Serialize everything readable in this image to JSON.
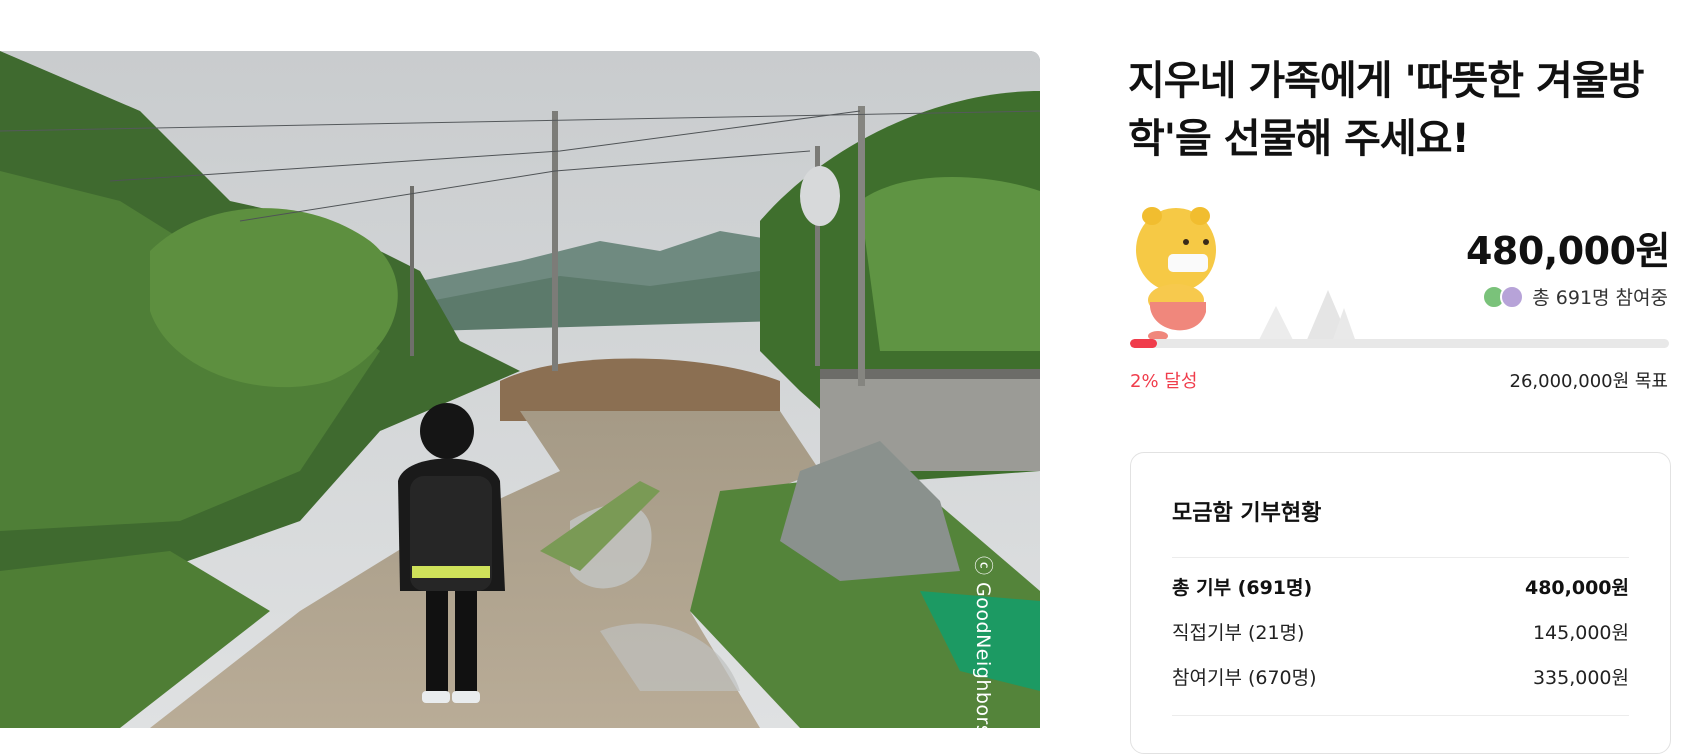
{
  "campaign": {
    "title": "지우네 가족에게 '따뜻한 겨울방학'을 선물해 주세요!",
    "photo_credit": "ⓒ GoodNeighbors",
    "raised_amount": "480,000원",
    "participants_text": "총 691명 참여중",
    "progress_fraction": 0.02,
    "achieved_text": "2% 달성",
    "goal_text": "26,000,000원 목표",
    "accent_color": "#f03c4b"
  },
  "donation_box": {
    "title": "모금함 기부현황",
    "rows": [
      {
        "label": "총 기부 (691명)",
        "value": "480,000원"
      },
      {
        "label": "직접기부 (21명)",
        "value": "145,000원"
      },
      {
        "label": "참여기부 (670명)",
        "value": "335,000원"
      }
    ]
  }
}
